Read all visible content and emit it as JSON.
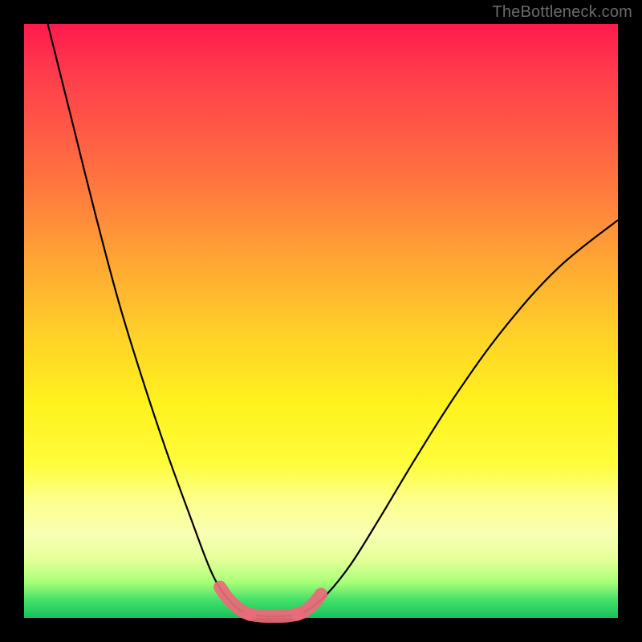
{
  "watermark": "TheBottleneck.com",
  "chart_data": {
    "type": "line",
    "title": "",
    "xlabel": "",
    "ylabel": "",
    "xlim": [
      0,
      100
    ],
    "ylim": [
      0,
      100
    ],
    "grid": false,
    "legend": false,
    "background": "heat-gradient",
    "series": [
      {
        "name": "left-curve",
        "color": "#000000",
        "x": [
          4,
          8,
          12,
          16,
          20,
          24,
          28,
          31,
          33,
          35,
          36.5,
          38
        ],
        "y": [
          100,
          84,
          68,
          53,
          40,
          28,
          17,
          9,
          5,
          2.5,
          1.2,
          0.6
        ]
      },
      {
        "name": "valley-floor",
        "color": "#000000",
        "x": [
          38,
          40,
          42,
          44,
          46
        ],
        "y": [
          0.6,
          0.3,
          0.25,
          0.3,
          0.6
        ]
      },
      {
        "name": "right-curve",
        "color": "#000000",
        "x": [
          46,
          48,
          51,
          55,
          60,
          66,
          73,
          81,
          90,
          100
        ],
        "y": [
          0.6,
          1.5,
          4,
          9,
          17,
          27,
          38,
          49,
          59,
          67
        ]
      },
      {
        "name": "left-highlight",
        "color": "#ec6a7a",
        "thick": true,
        "x": [
          33,
          34,
          35,
          36,
          37,
          38
        ],
        "y": [
          5.2,
          3.7,
          2.6,
          1.7,
          1.0,
          0.6
        ]
      },
      {
        "name": "floor-highlight",
        "color": "#ec6a7a",
        "thick": true,
        "x": [
          38,
          40,
          42,
          44,
          46
        ],
        "y": [
          0.6,
          0.3,
          0.25,
          0.3,
          0.6
        ]
      },
      {
        "name": "right-highlight",
        "color": "#ec6a7a",
        "thick": true,
        "x": [
          46,
          47,
          48,
          49,
          50
        ],
        "y": [
          0.6,
          1.0,
          1.7,
          2.7,
          4.0
        ]
      }
    ]
  }
}
